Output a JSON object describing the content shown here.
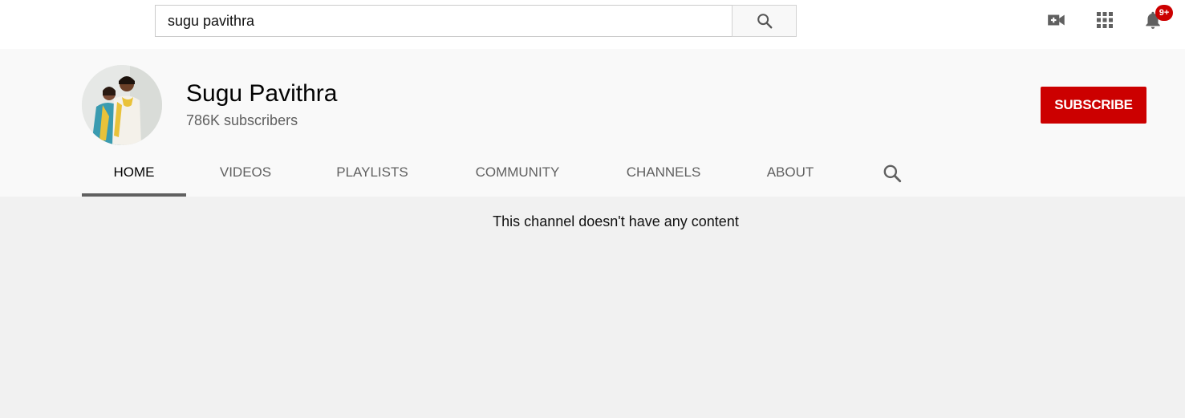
{
  "search": {
    "value": "sugu pavithra"
  },
  "icons": {
    "search": "search-icon",
    "create_video": "video-camera-plus-icon",
    "apps": "apps-grid-icon",
    "notifications": "bell-icon",
    "tab_search": "search-icon"
  },
  "notifications": {
    "badge": "9+"
  },
  "channel": {
    "name": "Sugu Pavithra",
    "subscribers": "786K subscribers",
    "subscribe_label": "SUBSCRIBE"
  },
  "tabs": [
    {
      "label": "HOME",
      "active": true
    },
    {
      "label": "VIDEOS",
      "active": false
    },
    {
      "label": "PLAYLISTS",
      "active": false
    },
    {
      "label": "COMMUNITY",
      "active": false
    },
    {
      "label": "CHANNELS",
      "active": false
    },
    {
      "label": "ABOUT",
      "active": false
    }
  ],
  "content": {
    "empty_message": "This channel doesn't have any content"
  },
  "colors": {
    "brand_red": "#cc0000",
    "text_secondary": "#606060",
    "header_bg": "#f9f9f9",
    "page_bg": "#f1f1f1"
  }
}
